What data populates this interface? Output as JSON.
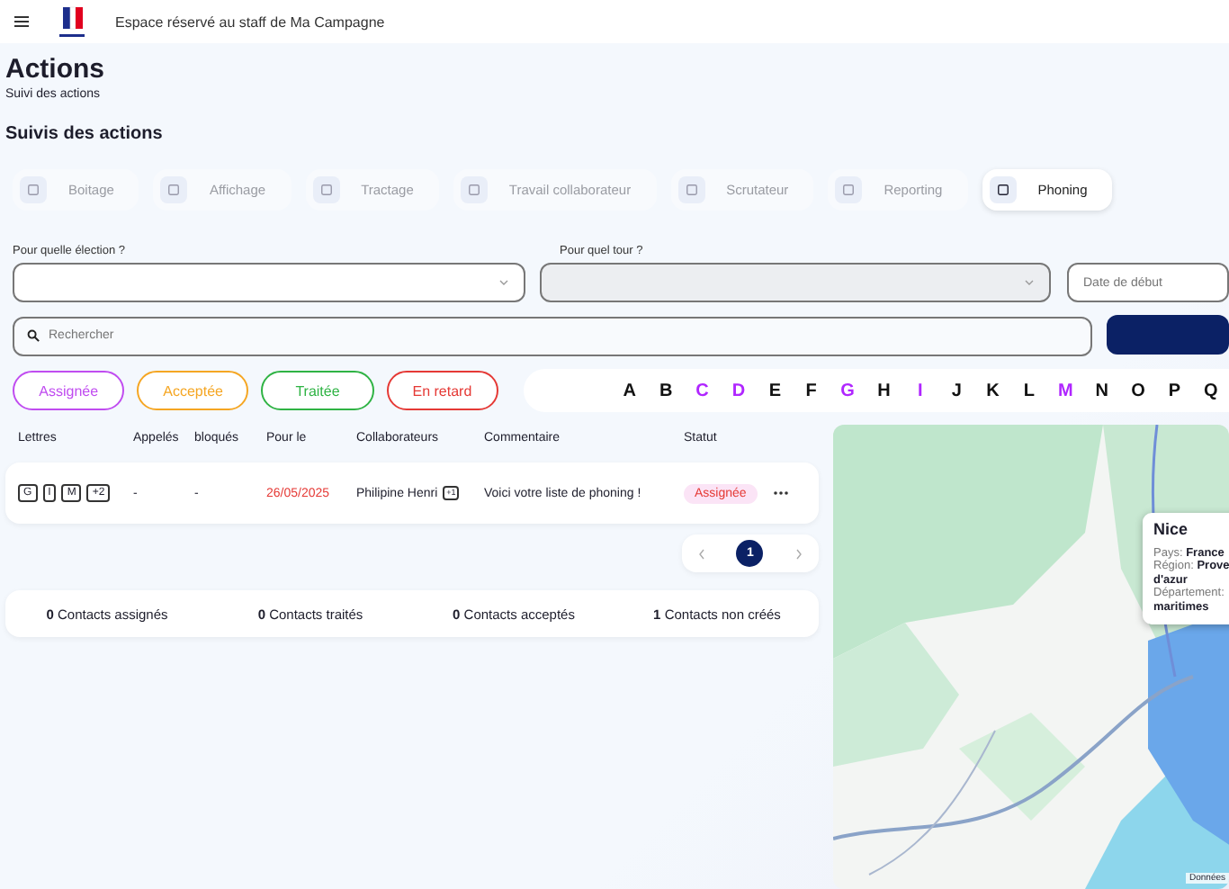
{
  "header": {
    "title": "Espace réservé au staff de Ma Campagne"
  },
  "page": {
    "title": "Actions",
    "subtitle": "Suivi des actions",
    "section": "Suivis des actions"
  },
  "tabs": [
    {
      "label": "Boitage",
      "selected": false
    },
    {
      "label": "Affichage",
      "selected": false
    },
    {
      "label": "Tractage",
      "selected": false
    },
    {
      "label": "Travail collaborateur",
      "selected": false
    },
    {
      "label": "Scrutateur",
      "selected": false
    },
    {
      "label": "Reporting",
      "selected": false
    },
    {
      "label": "Phoning",
      "selected": true
    }
  ],
  "filters": {
    "election_label": "Pour quelle élection ?",
    "tour_label": "Pour quel tour ?",
    "tour_disabled": true,
    "date_placeholder": "Date de début",
    "search_placeholder": "Rechercher"
  },
  "status_chips": [
    {
      "label": "Assignée",
      "color": "#c04cf0"
    },
    {
      "label": "Acceptée",
      "color": "#f5a623"
    },
    {
      "label": "Traitée",
      "color": "#2fb344"
    },
    {
      "label": "En retard",
      "color": "#e53935"
    }
  ],
  "letters": [
    {
      "letter": "A",
      "highlighted": false
    },
    {
      "letter": "B",
      "highlighted": false
    },
    {
      "letter": "C",
      "highlighted": true
    },
    {
      "letter": "D",
      "highlighted": true
    },
    {
      "letter": "E",
      "highlighted": false
    },
    {
      "letter": "F",
      "highlighted": false
    },
    {
      "letter": "G",
      "highlighted": true
    },
    {
      "letter": "H",
      "highlighted": false
    },
    {
      "letter": "I",
      "highlighted": true
    },
    {
      "letter": "J",
      "highlighted": false
    },
    {
      "letter": "K",
      "highlighted": false
    },
    {
      "letter": "L",
      "highlighted": false
    },
    {
      "letter": "M",
      "highlighted": true
    },
    {
      "letter": "N",
      "highlighted": false
    },
    {
      "letter": "O",
      "highlighted": false
    },
    {
      "letter": "P",
      "highlighted": false
    },
    {
      "letter": "Q",
      "highlighted": false
    }
  ],
  "table": {
    "columns": [
      "Lettres",
      "Appelés",
      "bloqués",
      "Pour le",
      "Collaborateurs",
      "Commentaire",
      "Statut"
    ],
    "rows": [
      {
        "letters": [
          "G",
          "I",
          "M",
          "+2"
        ],
        "called": "-",
        "blocked": "-",
        "date": "26/05/2025",
        "collaborator": "Philipine Henri",
        "collaborator_extra": "+1",
        "comment": "Voici votre liste de phoning !",
        "status": "Assignée"
      }
    ]
  },
  "pagination": {
    "pages": [
      {
        "label": "1",
        "selected": true
      }
    ]
  },
  "stats": [
    {
      "count": "0",
      "label": "Contacts assignés"
    },
    {
      "count": "0",
      "label": "Contacts traités"
    },
    {
      "count": "0",
      "label": "Contacts acceptés"
    },
    {
      "count": "1",
      "label": "Contacts non créés"
    }
  ],
  "map": {
    "kind": "picture",
    "popup": {
      "title": "Nice",
      "lines": [
        {
          "key": "Pays:",
          "value": "France"
        },
        {
          "key": "Région:",
          "value": "Prove"
        },
        {
          "value": "d'azur"
        },
        {
          "key": "Département:"
        },
        {
          "value": "maritimes"
        }
      ]
    },
    "attribution": "Données"
  }
}
